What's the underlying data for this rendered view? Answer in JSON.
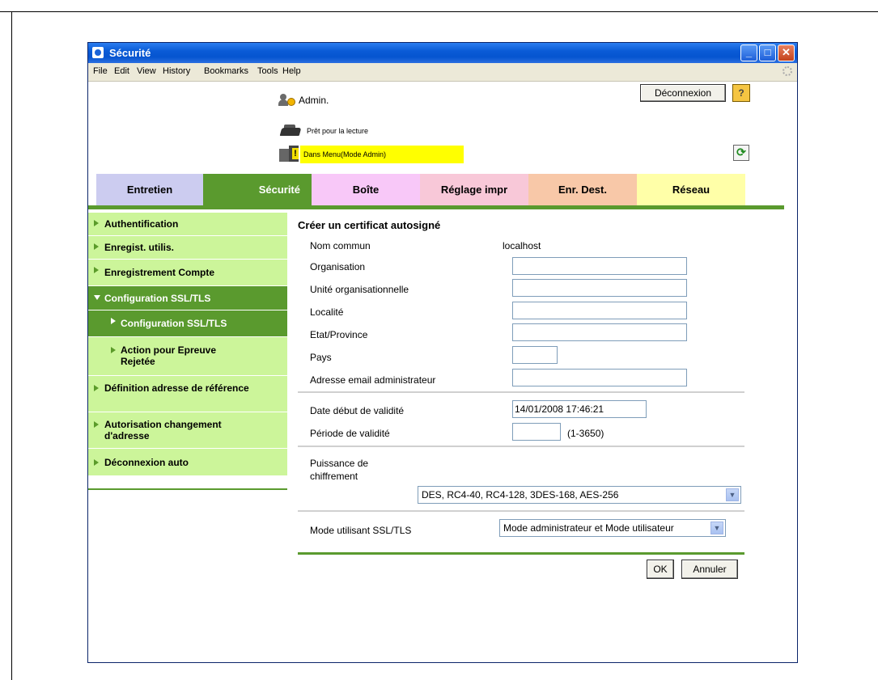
{
  "window": {
    "title": "Sécurité"
  },
  "menubar": {
    "items": [
      "File",
      "Edit",
      "View",
      "History",
      "Bookmarks",
      "Tools",
      "Help"
    ]
  },
  "header": {
    "user": "Admin.",
    "logout_label": "Déconnexion",
    "help_label": "?",
    "status_ready": "Prêt pour la lecture",
    "status_mode": "Dans Menu(Mode Admin)"
  },
  "tabs": [
    {
      "label": "Entretien",
      "color": "#ccccf0"
    },
    {
      "label": "Sécurité",
      "color": "#5a9a2e"
    },
    {
      "label": "Boîte",
      "color": "#f8c8f8"
    },
    {
      "label": "Réglage impr",
      "color": "#f8c8d8"
    },
    {
      "label": "Enr. Dest.",
      "color": "#f8c8a8"
    },
    {
      "label": "Réseau",
      "color": "#ffffa8"
    }
  ],
  "sidebar": {
    "items": [
      {
        "label": "Authentification"
      },
      {
        "label": "Enregist. utilis."
      },
      {
        "label": "Enregistrement Compte"
      },
      {
        "label": "Configuration SSL/TLS"
      },
      {
        "label": "Configuration SSL/TLS"
      },
      {
        "label": "Action pour Epreuve Rejetée"
      },
      {
        "label": "Définition adresse de référence"
      },
      {
        "label": "Autorisation changement d'adresse"
      },
      {
        "label": "Déconnexion auto"
      }
    ]
  },
  "form": {
    "title": "Créer un certificat autosigné",
    "common_name_label": "Nom commun",
    "common_name_value": "localhost",
    "organisation_label": "Organisation",
    "organisation_value": "",
    "unit_label": "Unité organisationnelle",
    "unit_value": "",
    "locality_label": "Localité",
    "locality_value": "",
    "state_label": "Etat/Province",
    "state_value": "",
    "country_label": "Pays",
    "country_value": "",
    "email_label": "Adresse email administrateur",
    "email_value": "",
    "start_label": "Date début de validité",
    "start_value": "14/01/2008 17:46:21",
    "period_label": "Période de validité",
    "period_value": "",
    "period_range": "(1-3650)",
    "cipher_label_1": "Puissance de",
    "cipher_label_2": "chiffrement",
    "cipher_value": "DES, RC4-40, RC4-128, 3DES-168, AES-256",
    "mode_label": "Mode utilisant SSL/TLS",
    "mode_value": "Mode administrateur et Mode utilisateur",
    "ok_label": "OK",
    "cancel_label": "Annuler"
  }
}
